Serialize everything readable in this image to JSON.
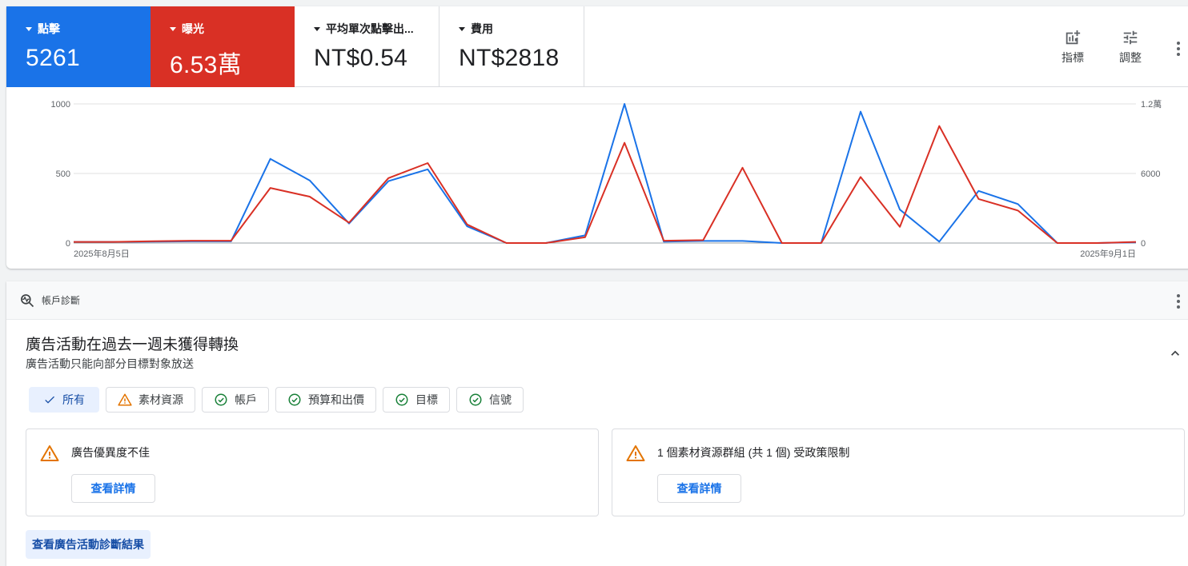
{
  "metrics": [
    {
      "label": "點擊",
      "value": "5261"
    },
    {
      "label": "曝光",
      "value": "6.53萬"
    },
    {
      "label": "平均單次點擊出...",
      "value": "NT$0.54"
    },
    {
      "label": "費用",
      "value": "NT$2818"
    }
  ],
  "toolbar": {
    "metrics_label": "指標",
    "adjust_label": "調整"
  },
  "colors": {
    "clicks": "#1a73e8",
    "impressions": "#d93025"
  },
  "chart_data": {
    "type": "line",
    "x_labels": [
      "2025年8月5日",
      "2025年9月1日"
    ],
    "y_left_ticks": [
      "1000",
      "500",
      "0"
    ],
    "y_right_ticks": [
      "1.2萬",
      "6000",
      "0"
    ],
    "ylim_left": [
      0,
      1000
    ],
    "ylim_right": [
      0,
      12000
    ],
    "grid": true,
    "series": [
      {
        "name": "點擊",
        "axis": "left",
        "color": "#1a73e8",
        "values": [
          8,
          8,
          10,
          12,
          12,
          605,
          450,
          140,
          445,
          530,
          120,
          0,
          0,
          55,
          1000,
          10,
          15,
          15,
          0,
          0,
          945,
          240,
          10,
          375,
          280,
          0,
          0,
          5
        ]
      },
      {
        "name": "曝光",
        "axis": "right",
        "color": "#d93025",
        "values": [
          100,
          100,
          150,
          200,
          200,
          4750,
          4000,
          1750,
          5600,
          6900,
          1600,
          0,
          0,
          500,
          8650,
          200,
          250,
          6500,
          0,
          0,
          5700,
          1400,
          10100,
          3800,
          2800,
          0,
          0,
          100
        ]
      }
    ]
  },
  "diagnostics": {
    "header": "帳戶診斷",
    "title": "廣告活動在過去一週未獲得轉換",
    "subtitle": "廣告活動只能向部分目標對象放送",
    "chips": [
      {
        "label": "所有",
        "status": "selected"
      },
      {
        "label": "素材資源",
        "status": "warning"
      },
      {
        "label": "帳戶",
        "status": "ok"
      },
      {
        "label": "預算和出價",
        "status": "ok"
      },
      {
        "label": "目標",
        "status": "ok"
      },
      {
        "label": "信號",
        "status": "ok"
      }
    ],
    "issues": [
      {
        "title": "廣告優異度不佳",
        "button": "查看詳情"
      },
      {
        "title": "1 個素材資源群組 (共 1 個) 受政策限制",
        "button": "查看詳情"
      }
    ],
    "footer_button": "查看廣告活動診斷結果"
  }
}
